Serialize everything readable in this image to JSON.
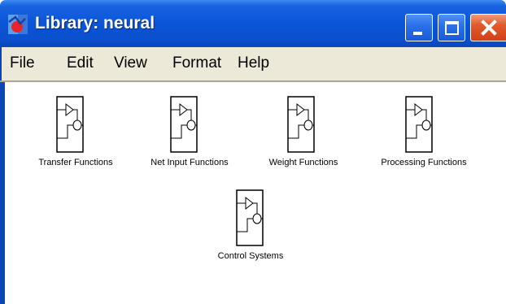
{
  "window": {
    "title": "Library: neural",
    "app_icon": "simulink-library-icon",
    "controls": {
      "minimize": "minimize-icon",
      "maximize": "maximize-icon",
      "close": "close-icon"
    }
  },
  "menubar": {
    "items": [
      "File",
      "Edit",
      "View",
      "Format",
      "Help"
    ]
  },
  "blocks": [
    {
      "label": "Transfer Functions",
      "icon": "subsystem-block-icon"
    },
    {
      "label": "Net Input Functions",
      "icon": "subsystem-block-icon"
    },
    {
      "label": "Weight Functions",
      "icon": "subsystem-block-icon"
    },
    {
      "label": "Processing Functions",
      "icon": "subsystem-block-icon"
    },
    {
      "label": "Control Systems",
      "icon": "subsystem-block-icon"
    }
  ],
  "colors": {
    "titlebar": "#0a55d8",
    "close_button": "#d2401a",
    "menubar": "#ece9d8",
    "frame": "#0a46b8"
  }
}
